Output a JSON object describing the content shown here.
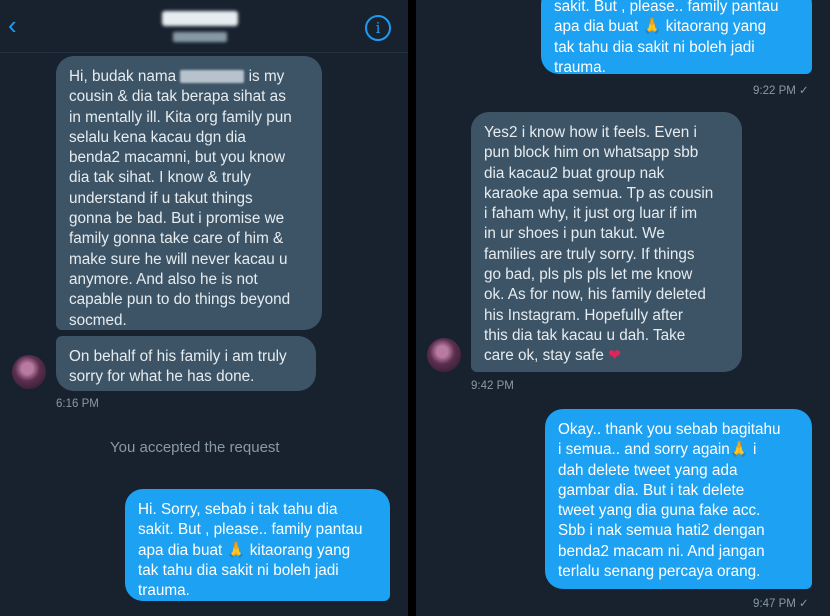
{
  "header": {
    "back_icon": "chevron-left-icon",
    "info_icon": "info-icon",
    "info_glyph": "i"
  },
  "left": {
    "messages": [
      {
        "from": "them",
        "text_a": "Hi, budak nama",
        "text_b": "is my\ncousin & dia tak berapa sihat as\nin mentally ill. Kita org family pun\nselalu kena kacau dgn dia\nbenda2 macamni, but you know\ndia tak sihat. I know & truly\nunderstand if u takut things\ngonna be bad. But i promise we\nfamily gonna take care of him &\nmake sure he will never kacau u\nanymore. And also he is not\ncapable pun to do things beyond\nsocmed."
      },
      {
        "from": "them",
        "text": "On behalf of his family i am truly\nsorry for what he has done."
      }
    ],
    "stamp_1": "6:16 PM",
    "system_notice": "You accepted the request",
    "outgoing_a": "Hi. Sorry, sebab i tak tahu dia\nsakit. But , please.. family pantau\napa dia buat",
    "outgoing_emoji": "🙏",
    "outgoing_b": " kitaorang yang\ntak tahu dia sakit ni boleh jadi\ntrauma."
  },
  "right": {
    "top_a": "sakit. But , please.. family pantau\napa dia buat",
    "top_emoji": "🙏",
    "top_b": " kitaorang yang\ntak tahu dia sakit ni boleh jadi\ntrauma.",
    "stamp_1": "9:22 PM ✓",
    "incoming": "Yes2 i know how it feels. Even i\npun block him on whatsapp sbb\ndia kacau2 buat group nak\nkaraoke apa semua. Tp as cousin\ni faham why, it just org luar if im\nin ur shoes i pun takut. We\nfamilies are truly sorry. If things\ngo bad, pls pls pls let me know\nok. As for now, his family deleted\nhis Instagram. Hopefully after\nthis dia tak kacau u dah. Take\ncare ok, stay safe",
    "heart": "❤",
    "stamp_2": "9:42 PM",
    "reply_a": "Okay.. thank you sebab bagitahu\ni semua.. and sorry again",
    "reply_emoji": "🙏",
    "reply_b": " i\ndah delete tweet yang ada\ngambar dia. But i tak delete\ntweet yang dia guna fake acc.\nSbb i nak semua hati2 dengan\nbenda2 macam ni. And jangan\nterlalu senang percaya orang.",
    "stamp_3": "9:47 PM ✓"
  },
  "colors": {
    "background": "#18222e",
    "incoming": "#3d5466",
    "outgoing": "#1da1f2",
    "accent": "#1d9bf0"
  }
}
